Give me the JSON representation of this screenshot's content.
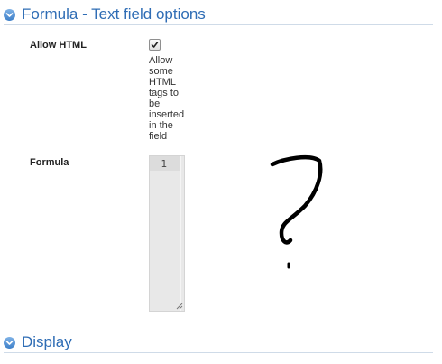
{
  "sections": {
    "formula": {
      "title": "Formula - Text field options"
    },
    "display": {
      "title": "Display"
    }
  },
  "fields": {
    "allow_html": {
      "label": "Allow HTML",
      "checked": true,
      "help": "Allow some HTML tags to be inserted in the field"
    },
    "formula": {
      "label": "Formula",
      "line_number": "1"
    }
  },
  "icons": {
    "section_toggle": "chevron-down-icon",
    "checkbox_check": "checkmark-icon",
    "editor_resize": "resize-grip-icon",
    "sketch": "question-mark-icon"
  },
  "colors": {
    "section_title": "#2f6db5",
    "section_rule": "#cfdbe8",
    "editor_bg": "#e8e8e8"
  }
}
